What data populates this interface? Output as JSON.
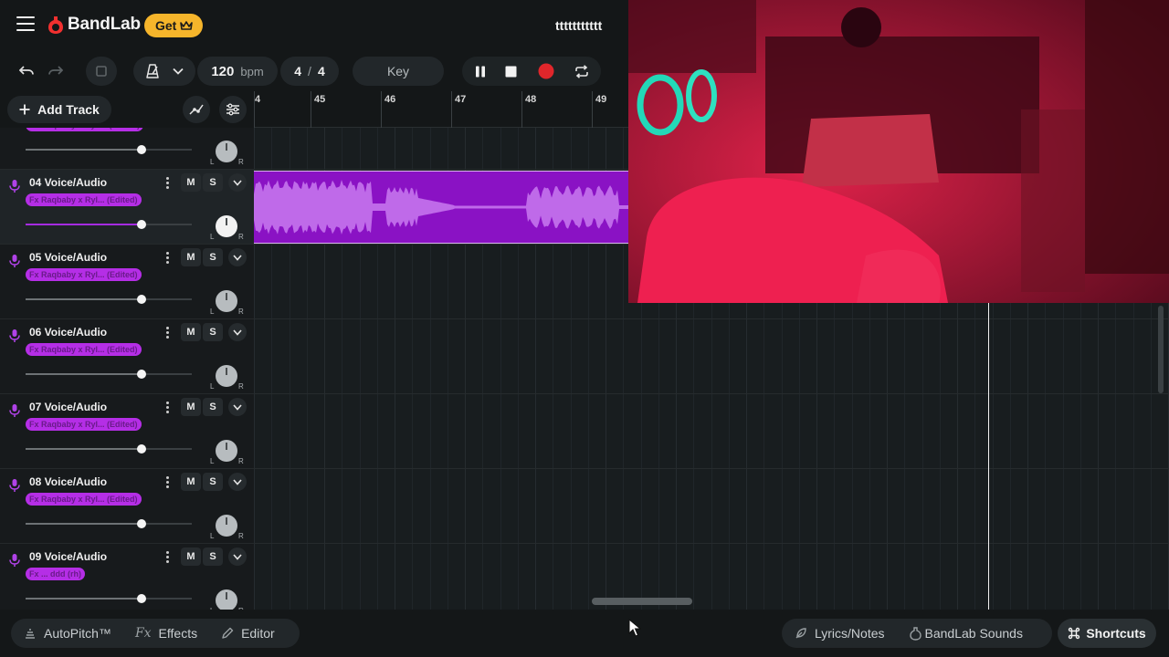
{
  "app": {
    "brand": "BandLab",
    "get_label": "Get",
    "project_title": "ttttttttttt"
  },
  "toolbar": {
    "bpm_value": "120",
    "bpm_unit": "bpm",
    "time_sig_top": "4",
    "time_sig_sep": "/",
    "time_sig_bottom": "4",
    "key_label": "Key",
    "record_color": "#e0262b"
  },
  "tracklist": {
    "add_track_label": "Add Track",
    "clip_color": "#8a12c4"
  },
  "ruler": {
    "partial_left": "4",
    "bars": [
      "45",
      "46",
      "47",
      "48",
      "49"
    ]
  },
  "tracks": [
    {
      "name": "",
      "fx": "Fx Raqbaby x Ryli... (Edited)",
      "volume": 0.7
    },
    {
      "name": "04  Voice/Audio",
      "fx": "Fx Raqbaby x Ryl... (Edited)",
      "volume": 0.7,
      "active": true
    },
    {
      "name": "05  Voice/Audio",
      "fx": "Fx Raqbaby x Ryl... (Edited)",
      "volume": 0.7
    },
    {
      "name": "06  Voice/Audio",
      "fx": "Fx Raqbaby x Ryl... (Edited)",
      "volume": 0.7
    },
    {
      "name": "07  Voice/Audio",
      "fx": "Fx Raqbaby x Ryl... (Edited)",
      "volume": 0.7
    },
    {
      "name": "08  Voice/Audio",
      "fx": "Fx Raqbaby x Ryl... (Edited)",
      "volume": 0.7
    },
    {
      "name": "09  Voice/Audio",
      "fx": "Fx ... ddd (rh)",
      "volume": 0.7
    }
  ],
  "track_controls": {
    "mute": "M",
    "solo": "S",
    "pan_left": "L",
    "pan_right": "R"
  },
  "bottom": {
    "autopitch": "AutoPitch™",
    "effects_prefix": "Fx",
    "effects": "Effects",
    "editor": "Editor",
    "lyrics": "Lyrics/Notes",
    "sounds": "BandLab Sounds",
    "shortcuts": "Shortcuts"
  }
}
